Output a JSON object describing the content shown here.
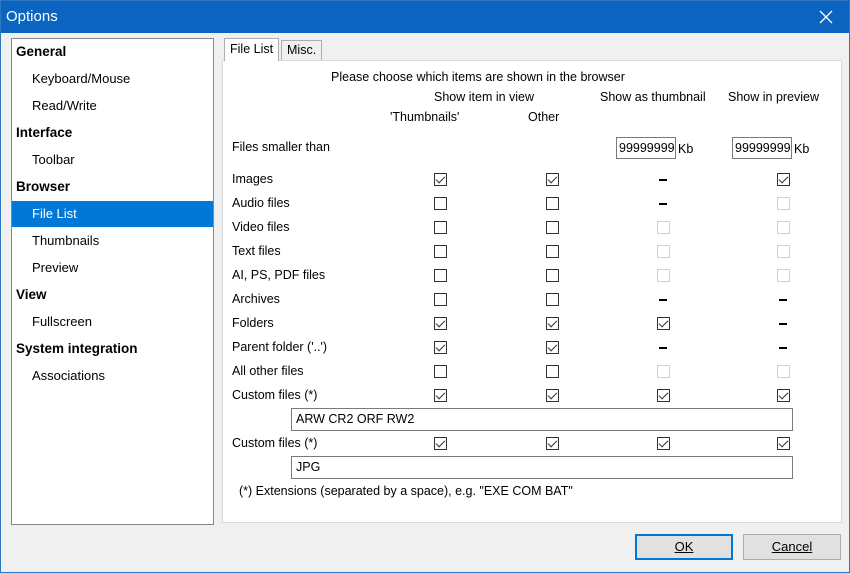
{
  "window": {
    "title": "Options"
  },
  "tree": [
    {
      "label": "General",
      "type": "cat"
    },
    {
      "label": "Keyboard/Mouse",
      "type": "sub"
    },
    {
      "label": "Read/Write",
      "type": "sub"
    },
    {
      "label": "Interface",
      "type": "cat"
    },
    {
      "label": "Toolbar",
      "type": "sub"
    },
    {
      "label": "Browser",
      "type": "cat"
    },
    {
      "label": "File List",
      "type": "sub",
      "selected": true
    },
    {
      "label": "Thumbnails",
      "type": "sub"
    },
    {
      "label": "Preview",
      "type": "sub"
    },
    {
      "label": "View",
      "type": "cat"
    },
    {
      "label": "Fullscreen",
      "type": "sub"
    },
    {
      "label": "System integration",
      "type": "cat"
    },
    {
      "label": "Associations",
      "type": "sub"
    }
  ],
  "tabs": [
    {
      "label": "File List",
      "active": true
    },
    {
      "label": "Misc.",
      "active": false
    }
  ],
  "panel": {
    "heading": "Please choose which items are shown in the browser",
    "col_show_in_view": "Show item in view",
    "col_thumbnails": "'Thumbnails'",
    "col_other": "Other",
    "col_show_as_thumbnail": "Show as thumbnail",
    "col_show_in_preview": "Show in preview",
    "files_smaller_label": "Files smaller than",
    "thumb_size_value": "99999999",
    "preview_size_value": "99999999",
    "kb_unit": "Kb",
    "rows": [
      {
        "label": "Images",
        "cells": [
          "checked",
          "checked",
          "dash",
          "checked"
        ]
      },
      {
        "label": "Audio files",
        "cells": [
          "unchecked",
          "unchecked",
          "dash",
          "disabled"
        ]
      },
      {
        "label": "Video files",
        "cells": [
          "unchecked",
          "unchecked",
          "disabled",
          "disabled"
        ]
      },
      {
        "label": "Text files",
        "cells": [
          "unchecked",
          "unchecked",
          "disabled",
          "disabled"
        ]
      },
      {
        "label": "AI, PS, PDF files",
        "cells": [
          "unchecked",
          "unchecked",
          "disabled",
          "disabled"
        ]
      },
      {
        "label": "Archives",
        "cells": [
          "unchecked",
          "unchecked",
          "dash",
          "dash"
        ]
      },
      {
        "label": "Folders",
        "cells": [
          "checked",
          "checked",
          "checked",
          "dash"
        ]
      },
      {
        "label": "Parent folder ('..')",
        "cells": [
          "checked",
          "checked",
          "dash",
          "dash"
        ]
      },
      {
        "label": "All other files",
        "cells": [
          "unchecked",
          "unchecked",
          "disabled",
          "disabled"
        ]
      },
      {
        "label": "Custom files (*)",
        "cells": [
          "checked",
          "checked",
          "checked",
          "checked"
        ],
        "extensions": "ARW CR2 ORF RW2"
      },
      {
        "label": "Custom files (*)",
        "cells": [
          "checked",
          "checked",
          "checked",
          "checked"
        ],
        "extensions": "JPG"
      }
    ],
    "footnote": "(*) Extensions (separated by a space), e.g. \"EXE COM BAT\""
  },
  "buttons": {
    "ok": "OK",
    "cancel": "Cancel"
  },
  "colors": {
    "titlebar": "#0a64c0",
    "selection": "#0078d7"
  }
}
